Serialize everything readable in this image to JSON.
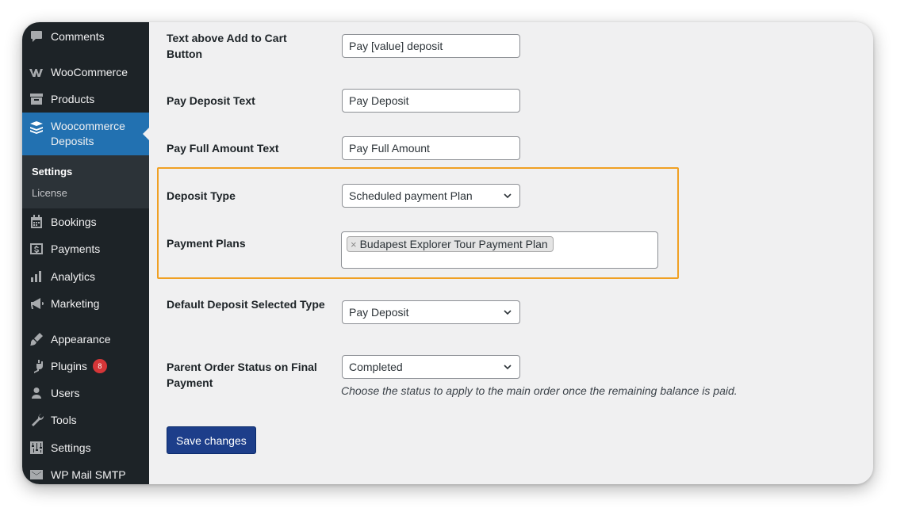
{
  "sidebar": {
    "comments": "Comments",
    "woocommerce": "WooCommerce",
    "products": "Products",
    "deposits": "Woocommerce Deposits",
    "submenu": {
      "settings": "Settings",
      "license": "License"
    },
    "bookings": "Bookings",
    "payments": "Payments",
    "analytics": "Analytics",
    "marketing": "Marketing",
    "appearance": "Appearance",
    "plugins": "Plugins",
    "plugins_badge": "8",
    "users": "Users",
    "tools": "Tools",
    "settings": "Settings",
    "wpmail": "WP Mail SMTP"
  },
  "form": {
    "text_above_label": "Text above Add to Cart Button",
    "text_above_value": "Pay [value] deposit",
    "pay_deposit_label": "Pay Deposit Text",
    "pay_deposit_value": "Pay Deposit",
    "pay_full_label": "Pay Full Amount Text",
    "pay_full_value": "Pay Full Amount",
    "deposit_type_label": "Deposit Type",
    "deposit_type_value": "Scheduled payment Plan",
    "payment_plans_label": "Payment Plans",
    "payment_plan_tag": "Budapest Explorer Tour Payment Plan",
    "payment_plan_remove": "×",
    "default_type_label": "Default Deposit Selected Type",
    "default_type_value": "Pay Deposit",
    "parent_status_label": "Parent Order Status on Final Payment",
    "parent_status_value": "Completed",
    "parent_status_desc": "Choose the status to apply to the main order once the remaining balance is paid.",
    "save_label": "Save changes"
  },
  "colors": {
    "sidebar_bg": "#1d2327",
    "active_bg": "#2271b1",
    "highlight": "#f0a023",
    "save_bg": "#1d3e8a"
  }
}
